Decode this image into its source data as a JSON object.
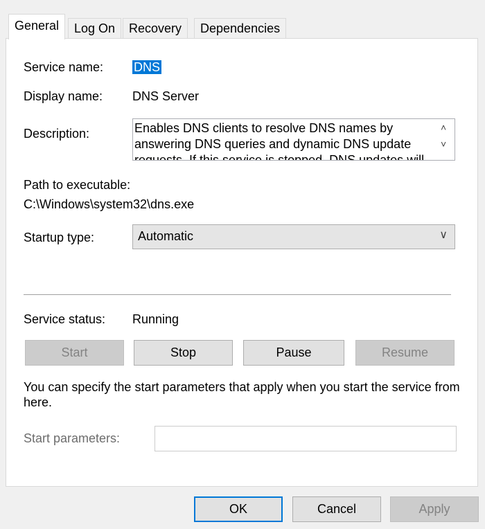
{
  "tabs": [
    {
      "label": "General",
      "active": true
    },
    {
      "label": "Log On",
      "active": false
    },
    {
      "label": "Recovery",
      "active": false
    },
    {
      "label": "Dependencies",
      "active": false
    }
  ],
  "general": {
    "service_name_label": "Service name:",
    "service_name_value": "DNS",
    "display_name_label": "Display name:",
    "display_name_value": "DNS Server",
    "description_label": "Description:",
    "description_value": "Enables DNS clients to resolve DNS names by answering DNS queries and dynamic DNS update requests. If this service is stopped, DNS updates will",
    "path_label": "Path to executable:",
    "path_value": "C:\\Windows\\system32\\dns.exe",
    "startup_label": "Startup type:",
    "startup_value": "Automatic",
    "status_label": "Service status:",
    "status_value": "Running",
    "start_btn": "Start",
    "stop_btn": "Stop",
    "pause_btn": "Pause",
    "resume_btn": "Resume",
    "hint": "You can specify the start parameters that apply when you start the service from here.",
    "params_label": "Start parameters:",
    "params_value": ""
  },
  "dialog": {
    "ok": "OK",
    "cancel": "Cancel",
    "apply": "Apply"
  },
  "colors": {
    "selection": "#0078d7",
    "disabled_text": "#838383"
  }
}
